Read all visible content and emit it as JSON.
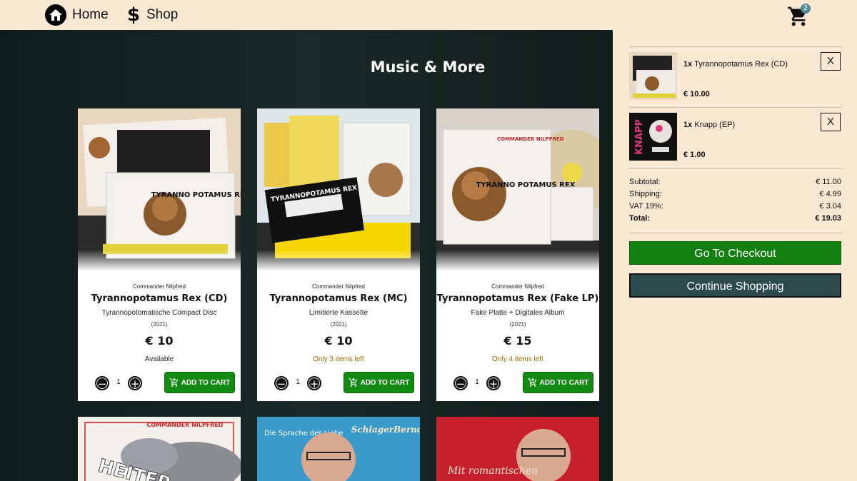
{
  "nav": {
    "home_label": "Home",
    "home_icon": "home-icon",
    "shop_label": "Shop",
    "shop_icon": "dollar-icon",
    "cart_icon": "cart-icon",
    "cart_count": "2"
  },
  "main": {
    "title": "Music & More"
  },
  "products": [
    {
      "artist": "Commander Nilpfred",
      "title": "Tyrannopotamus Rex (CD)",
      "subtitle": "Tyrannopotomatische Compact Disc",
      "year": "(2021)",
      "price": "€ 10",
      "stock": "Available",
      "qty": "1",
      "add_label": "ADD TO CART"
    },
    {
      "artist": "Commander Nilpfred",
      "title": "Tyrannopotamus Rex (MC)",
      "subtitle": "Limitierte Kassette",
      "year": "(2021)",
      "price": "€ 10",
      "stock": "Only 3 items left",
      "qty": "1",
      "add_label": "ADD TO CART"
    },
    {
      "artist": "Commander Nilpfred",
      "title": "Tyrannopotamus Rex (Fake LP)",
      "subtitle": "Fake Platte + Digitales Album",
      "year": "(2021)",
      "price": "€ 15",
      "stock": "Only 4 items left",
      "qty": "1",
      "add_label": "ADD TO CART"
    }
  ],
  "cover_texts": {
    "cd": "TYRANNO POTAMUS REX",
    "mc": "TYRANNOPOTAMUS REX",
    "lp": "TYRANNO POTAMUS REX",
    "lp_brand": "COMMANDER NILPFRED",
    "heiter": "HEITER",
    "heiter_brand": "COMMANDER NILPFRED",
    "schlager_brand": "SchlagerBernd",
    "schlager_text": "Die Sprache der Liebe",
    "romantic_text": "Mit romantischen"
  },
  "cart": {
    "items": [
      {
        "qty": "1x",
        "name": "Tyrannopotamus Rex (CD)",
        "price": "€ 10.00",
        "remove": "X"
      },
      {
        "qty": "1x",
        "name": "Knapp (EP)",
        "price": "€ 1.00",
        "remove": "X",
        "thumb_text": "KNAPP"
      }
    ],
    "subtotal_label": "Subtotal:",
    "subtotal": "€ 11.00",
    "shipping_label": "Shipping:",
    "shipping": "€ 4.99",
    "vat_label": "VAT 19%:",
    "vat": "€ 3.04",
    "total_label": "Total:",
    "total": "€ 19.03",
    "checkout_label": "Go To Checkout",
    "continue_label": "Continue Shopping"
  },
  "colors": {
    "accent_green": "#138a13",
    "dark_teal": "#2d4b4c",
    "cream": "#fbe8d3",
    "low_stock": "#9a6a00"
  }
}
